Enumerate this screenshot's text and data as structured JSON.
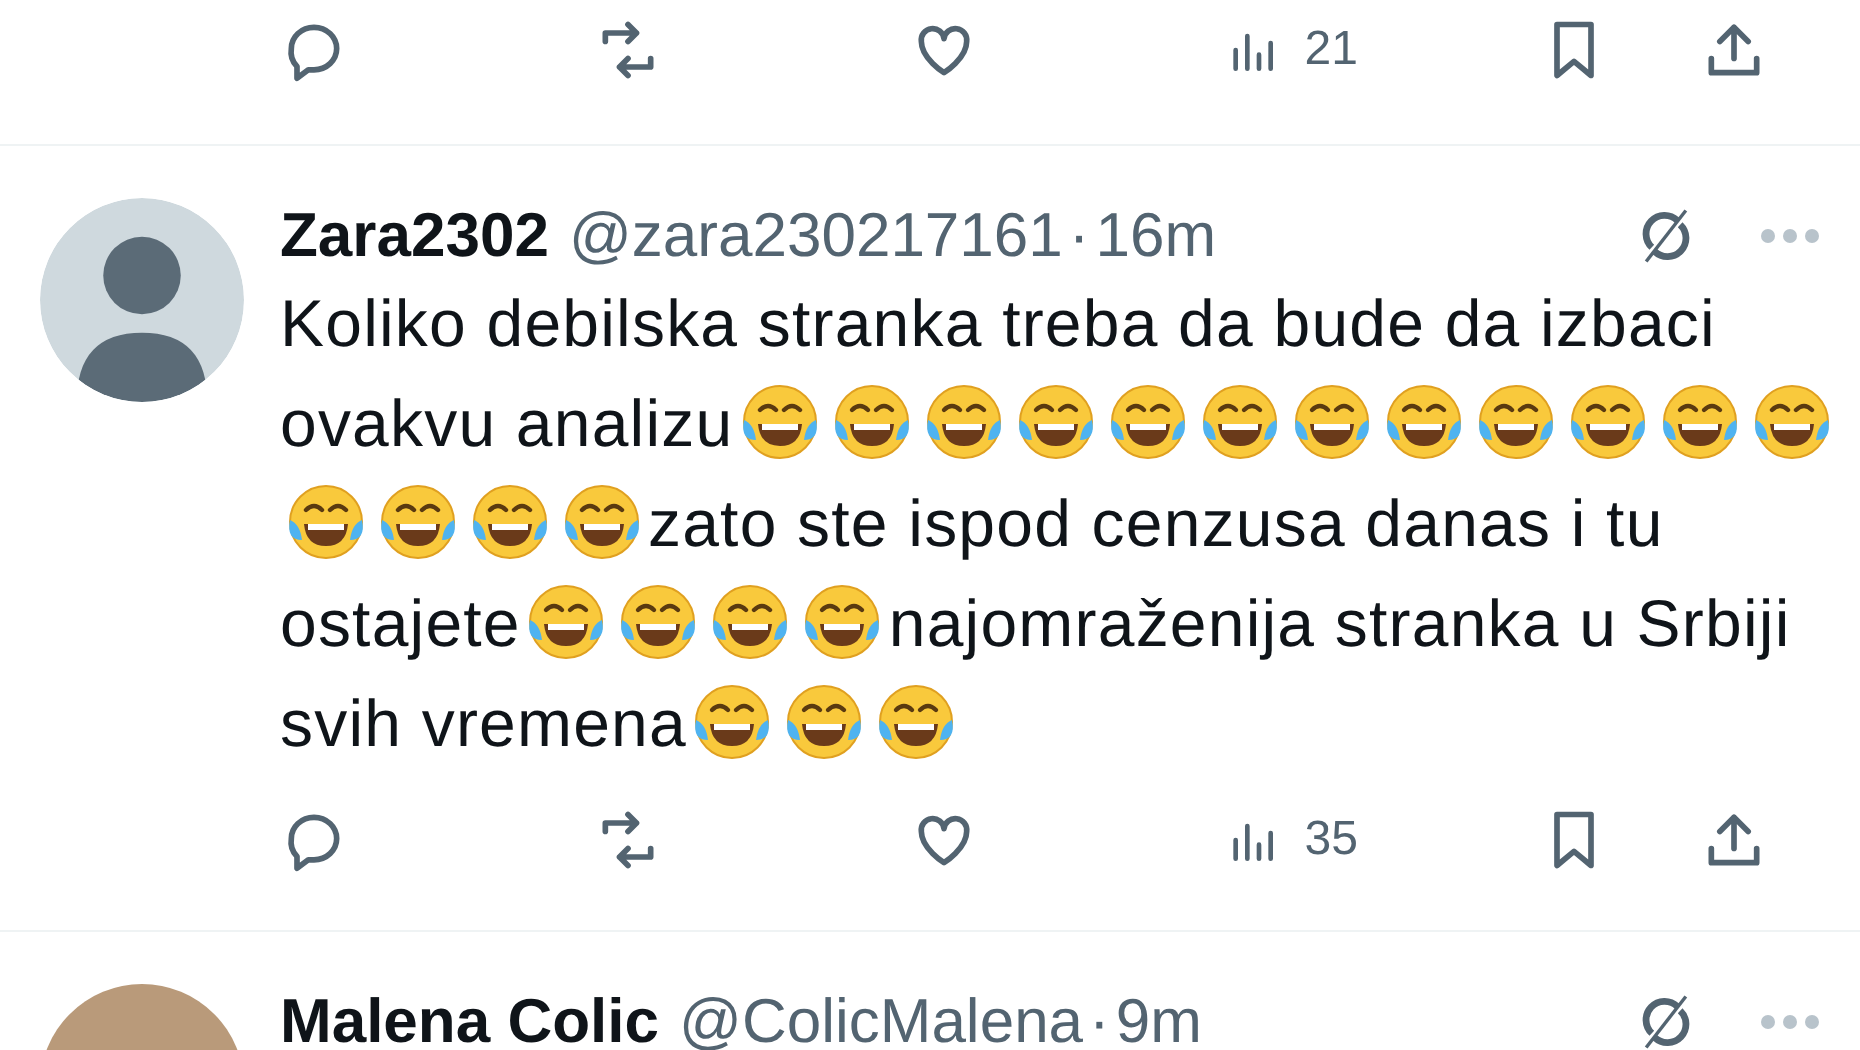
{
  "top_actions": {
    "views": "21"
  },
  "tweets": [
    {
      "name": "Zara2302",
      "handle": "@zara230217161",
      "dot": "·",
      "time": "16m",
      "avatar": {
        "kind": "default"
      },
      "body": [
        {
          "kind": "text",
          "text": "Koliko debilska stranka treba da bude da izbaci ovakvu analizu"
        },
        {
          "kind": "emoji"
        },
        {
          "kind": "emoji"
        },
        {
          "kind": "emoji"
        },
        {
          "kind": "emoji"
        },
        {
          "kind": "emoji"
        },
        {
          "kind": "emoji"
        },
        {
          "kind": "emoji"
        },
        {
          "kind": "emoji"
        },
        {
          "kind": "emoji"
        },
        {
          "kind": "emoji"
        },
        {
          "kind": "emoji"
        },
        {
          "kind": "emoji"
        },
        {
          "kind": "emoji"
        },
        {
          "kind": "emoji"
        },
        {
          "kind": "emoji"
        },
        {
          "kind": "emoji"
        },
        {
          "kind": "text",
          "text": "zato ste ispod cenzusa danas i tu ostajete"
        },
        {
          "kind": "emoji"
        },
        {
          "kind": "emoji"
        },
        {
          "kind": "emoji"
        },
        {
          "kind": "emoji"
        },
        {
          "kind": "text",
          "text": "najomraženija stranka u Srbiji svih vremena"
        },
        {
          "kind": "emoji"
        },
        {
          "kind": "emoji"
        },
        {
          "kind": "emoji"
        }
      ],
      "actions": {
        "views": "35"
      }
    },
    {
      "name": "Malena Colic",
      "handle": "@ColicMalena",
      "dot": "·",
      "time": "9m",
      "avatar": {
        "kind": "photo"
      }
    }
  ]
}
